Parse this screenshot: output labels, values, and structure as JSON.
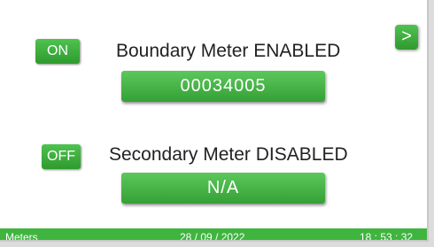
{
  "boundary_meter": {
    "state_label": "ON",
    "status_text": "Boundary Meter ENABLED",
    "reading": "00034005"
  },
  "secondary_meter": {
    "state_label": "OFF",
    "status_text": "Secondary Meter DISABLED",
    "reading": "N/A"
  },
  "nav": {
    "next_label": ">"
  },
  "status_bar": {
    "screen_name": "Meters",
    "date": "28 / 09 / 2022",
    "time": "18 : 53 : 32"
  },
  "colors": {
    "accent_green": "#3fb53f",
    "background": "#ffffff"
  }
}
